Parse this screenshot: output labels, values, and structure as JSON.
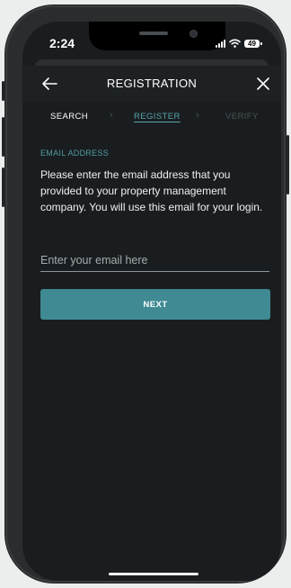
{
  "status_bar": {
    "time": "2:24",
    "battery": "49",
    "icons": [
      "signal-icon",
      "wifi-icon",
      "battery-icon"
    ]
  },
  "header": {
    "title": "REGISTRATION",
    "back_icon": "arrow-left-icon",
    "close_icon": "close-icon"
  },
  "steps": [
    {
      "label": "SEARCH",
      "state": "completed"
    },
    {
      "label": "REGISTER",
      "state": "active"
    },
    {
      "label": "VERIFY",
      "state": "upcoming"
    }
  ],
  "form": {
    "section_label": "EMAIL ADDRESS",
    "instructions": "Please enter the email address that you provided to your property management company. You will use this email for your login.",
    "email_value": "",
    "email_placeholder": "Enter your email here",
    "next_label": "NEXT"
  },
  "colors": {
    "background": "#1a1d1f",
    "accent": "#3f8a93",
    "accent_text": "#4f9ba2",
    "text": "#eef1f2",
    "muted": "#4a5356"
  }
}
